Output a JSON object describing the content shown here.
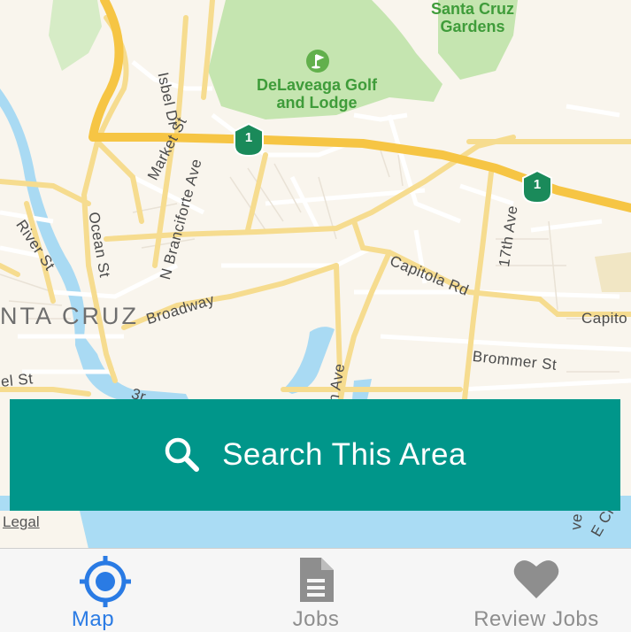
{
  "map": {
    "street_labels": {
      "isbel_dr": "Isbel Dr",
      "market_st": "Market St",
      "n_branciforte_ave": "N Branciforte Ave",
      "river_st": "River St",
      "ocean_st": "Ocean St",
      "broadway": "Broadway",
      "capitola_rd": "Capitola Rd",
      "capitola_edge": "Capito",
      "seventeenth_ave": "17th Ave",
      "brommer_st": "Brommer St",
      "bel_st": "el St",
      "third": "3r",
      "n_ave": "n Ave",
      "e_cliff": "E Cl",
      "ve": "ve"
    },
    "place_labels": {
      "santa_cruz_gardens_line1": "Santa Cruz",
      "santa_cruz_gardens_line2": "Gardens",
      "delaveaga_line1": "DeLaveaga Golf",
      "delaveaga_line2": "and Lodge",
      "city": "NTA CRUZ"
    },
    "highway_shields": [
      "1",
      "1"
    ],
    "legal": "Legal"
  },
  "search_button": {
    "label": "Search This Area",
    "icon": "search-icon",
    "color": "#00968a"
  },
  "tab_bar": {
    "active_color": "#2a7be4",
    "inactive_color": "#8e8e8e",
    "tabs": [
      {
        "label": "Map",
        "icon": "location-crosshair-icon",
        "active": true
      },
      {
        "label": "Jobs",
        "icon": "document-icon",
        "active": false
      },
      {
        "label": "Review Jobs",
        "icon": "heart-icon",
        "active": false
      }
    ]
  }
}
